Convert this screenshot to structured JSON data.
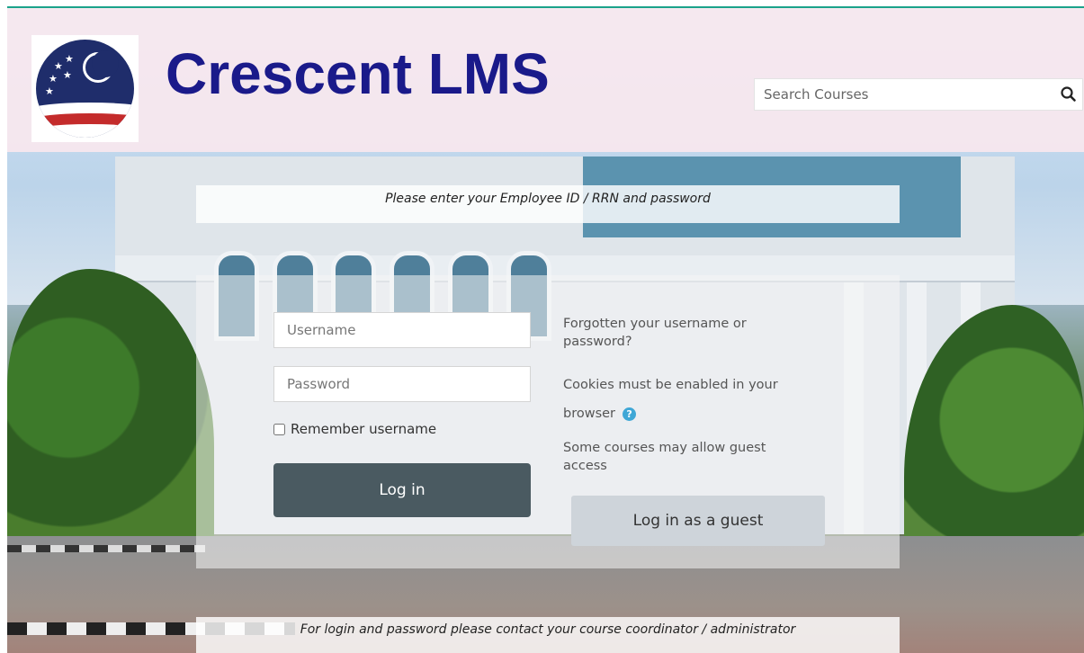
{
  "header": {
    "site_title": "Crescent LMS",
    "logo_name": "Crescent logo"
  },
  "search": {
    "placeholder": "Search Courses",
    "icon": "search-icon"
  },
  "notices": {
    "top": "Please enter your Employee ID / RRN and password",
    "bottom": "For login and password please contact your course coordinator / administrator"
  },
  "login": {
    "username_placeholder": "Username",
    "password_placeholder": "Password",
    "remember_label": "Remember username",
    "login_button": "Log in",
    "forgot_link": "Forgotten your username or password?",
    "cookies_note": "Cookies must be enabled in your browser",
    "guest_note": "Some courses may allow guest access",
    "guest_button": "Log in as a guest"
  },
  "colors": {
    "title": "#1a1a8a",
    "login_button": "#4a5a61",
    "guest_button": "#ced4da",
    "help_icon": "#3fa7d6",
    "accent_line": "#1aa38a"
  }
}
